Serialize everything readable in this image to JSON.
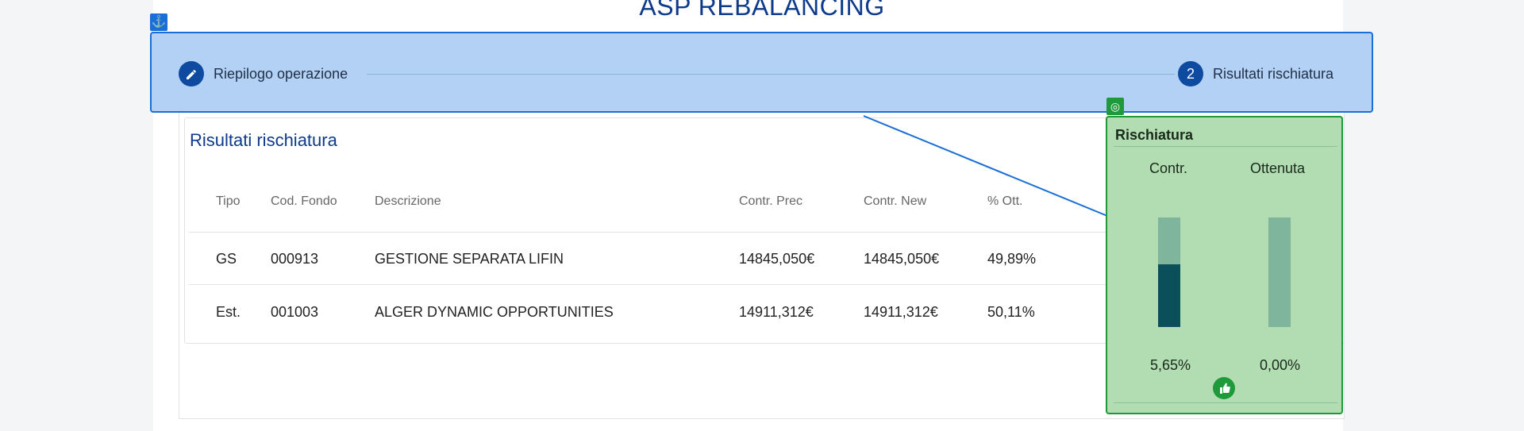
{
  "page": {
    "title": "ASP REBALANCING"
  },
  "stepper": {
    "anchor_icon": "⚓",
    "steps": [
      {
        "label": "Riepilogo operazione",
        "icon": "pencil-icon"
      },
      {
        "number": "2",
        "label": "Risultati rischiatura"
      }
    ]
  },
  "results": {
    "title": "Risultati rischiatura",
    "headers": [
      "Tipo",
      "Cod. Fondo",
      "Descrizione",
      "Contr. Prec",
      "Contr. New",
      "% Ott."
    ],
    "rows": [
      {
        "tipo": "GS",
        "cod": "000913",
        "descr": "GESTIONE SEPARATA LIFIN",
        "prec": "14845,050€",
        "new": "14845,050€",
        "ott": "49,89%"
      },
      {
        "tipo": "Est.",
        "cod": "001003",
        "descr": "ALGER DYNAMIC OPPORTUNITIES",
        "prec": "14911,312€",
        "new": "14911,312€",
        "ott": "50,11%"
      }
    ]
  },
  "risk": {
    "target_icon": "◎",
    "title": "Rischiatura",
    "columns": [
      {
        "label": "Contr.",
        "value": "5,65%",
        "fill_fraction": 0.57
      },
      {
        "label": "Ottenuta",
        "value": "0,00%",
        "fill_fraction": 0
      }
    ],
    "thumb_icon": "👍"
  },
  "colors": {
    "primary": "#0d3a8a",
    "stepper_bg": "#b3d1f5",
    "stepper_border": "#1a6fd6",
    "risk_bg": "#b2dcb2",
    "risk_border": "#1f9a3a",
    "bar_fill": "#0b4f5b",
    "bar_track": "#7fb59c"
  }
}
